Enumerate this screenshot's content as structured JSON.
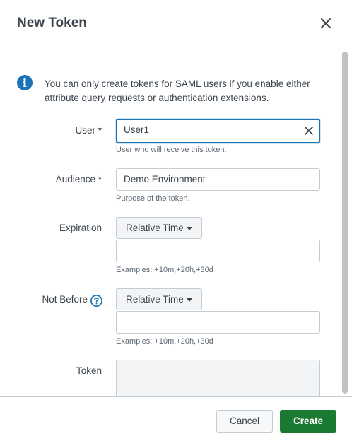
{
  "dialog": {
    "title": "New Token",
    "info_text": "You can only create tokens for SAML users if you enable either attribute query requests or authentication extensions."
  },
  "form": {
    "user": {
      "label": "User *",
      "value": "User1",
      "help": "User who will receive this token."
    },
    "audience": {
      "label": "Audience *",
      "value": "Demo Environment",
      "help": "Purpose of the token."
    },
    "expiration": {
      "label": "Expiration",
      "mode": "Relative Time",
      "value": "",
      "help": "Examples: +10m,+20h,+30d"
    },
    "not_before": {
      "label": "Not Before",
      "mode": "Relative Time",
      "value": "",
      "help": "Examples: +10m,+20h,+30d"
    },
    "token": {
      "label": "Token",
      "value": ""
    }
  },
  "footer": {
    "cancel_label": "Cancel",
    "create_label": "Create"
  },
  "colors": {
    "accent": "#1a73b5",
    "primary_button": "#1a7a32",
    "info_icon": "#1a73b5"
  },
  "icons": [
    "close-icon",
    "info-icon",
    "clear-icon",
    "caret-down-icon",
    "question-icon"
  ]
}
